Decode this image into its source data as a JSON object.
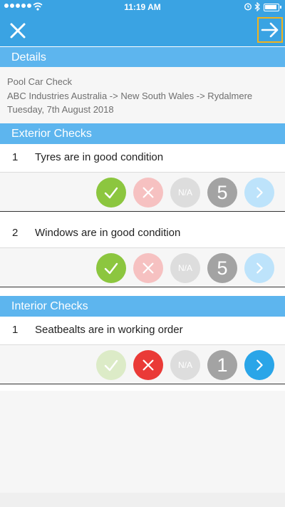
{
  "status_bar": {
    "time": "11:19 AM"
  },
  "toolbar": {
    "close_icon": "close-icon",
    "next_icon": "arrow-right-icon"
  },
  "details": {
    "header": "Details",
    "title": "Pool Car Check",
    "location": "ABC Industries Australia -> New South Wales -> Rydalmere",
    "date": "Tuesday, 7th August 2018"
  },
  "sections": [
    {
      "header": "Exterior Checks",
      "questions": [
        {
          "number": "1",
          "text": "Tyres are in good condition",
          "count": "5"
        },
        {
          "number": "2",
          "text": "Windows are in good condition",
          "count": "5"
        }
      ]
    },
    {
      "header": "Interior Checks",
      "questions": [
        {
          "number": "1",
          "text": "Seatbealts are in working order",
          "count": "1"
        }
      ]
    }
  ],
  "answer_labels": {
    "na": "N/A"
  },
  "colors": {
    "primary": "#3aa3e3",
    "section_header": "#5db5ee",
    "pass_active": "#8cc63f",
    "pass_faded": "#dcebc7",
    "fail_active": "#ea3a37",
    "fail_faded": "#f6c1c1",
    "na": "#dddddd",
    "count": "#a3a3a3",
    "next_active": "#2aa5e8",
    "next_faded": "#bde3fb",
    "highlight": "#f2b31c"
  }
}
